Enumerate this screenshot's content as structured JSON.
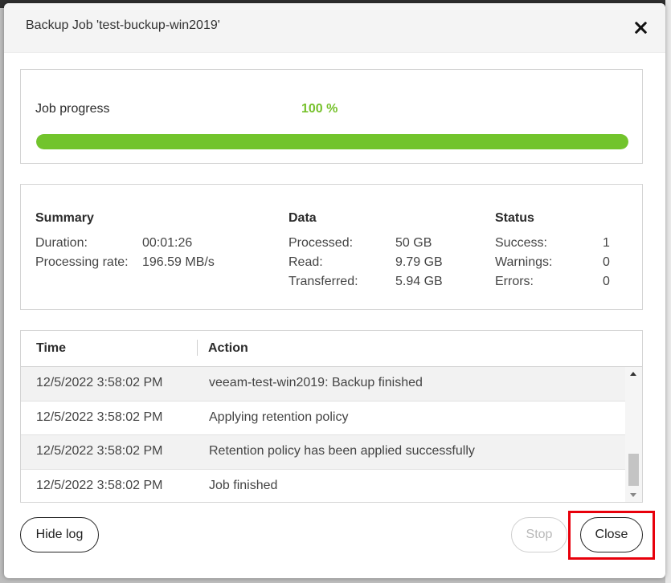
{
  "modal": {
    "title": "Backup Job 'test-buckup-win2019'"
  },
  "progress": {
    "label": "Job progress",
    "value_text": "100 %",
    "percent": 100,
    "color": "#72c42c"
  },
  "summary": {
    "heading": "Summary",
    "duration_label": "Duration:",
    "duration_value": "00:01:26",
    "rate_label": "Processing rate:",
    "rate_value": "196.59 MB/s"
  },
  "data": {
    "heading": "Data",
    "processed_label": "Processed:",
    "processed_value": "50 GB",
    "read_label": "Read:",
    "read_value": "9.79 GB",
    "transferred_label": "Transferred:",
    "transferred_value": "5.94 GB"
  },
  "status": {
    "heading": "Status",
    "success_label": "Success:",
    "success_value": "1",
    "warnings_label": "Warnings:",
    "warnings_value": "0",
    "errors_label": "Errors:",
    "errors_value": "0"
  },
  "log": {
    "columns": [
      "Time",
      "Action"
    ],
    "rows": [
      {
        "time": "12/5/2022 3:58:02 PM",
        "action": "veeam-test-win2019: Backup finished"
      },
      {
        "time": "12/5/2022 3:58:02 PM",
        "action": "Applying retention policy"
      },
      {
        "time": "12/5/2022 3:58:02 PM",
        "action": "Retention policy has been applied successfully"
      },
      {
        "time": "12/5/2022 3:58:02 PM",
        "action": "Job finished"
      }
    ]
  },
  "buttons": {
    "hide_log": "Hide log",
    "stop": "Stop",
    "close": "Close"
  },
  "highlight_color": "#e8000b"
}
